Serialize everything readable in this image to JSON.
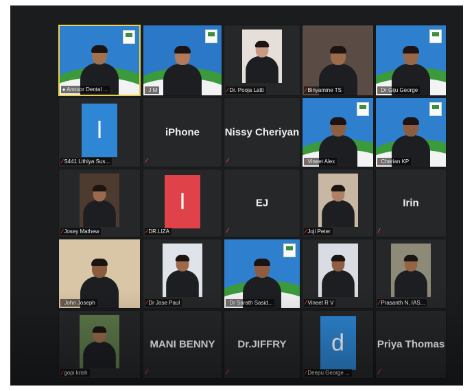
{
  "meeting": {
    "tiles": [
      {
        "id": "annoor",
        "name": "Annoor Dental ...",
        "kind": "video",
        "bg": "#2f7fcf",
        "skin": "#a0704f",
        "active": true
      },
      {
        "id": "jm",
        "name": "J M",
        "kind": "video",
        "bg": "#2c78c8",
        "skin": "#b27a58"
      },
      {
        "id": "pooja",
        "name": "Dr. Pooja Latti",
        "kind": "photo",
        "photo_bg": "#e6dfd9",
        "skin": "#c99983"
      },
      {
        "id": "binyamine",
        "name": "Binyamine TS",
        "kind": "video",
        "bg": "#5a4b44",
        "skin": "#9b6b4b"
      },
      {
        "id": "giju",
        "name": "Dr Giju George",
        "kind": "video",
        "bg": "#2f7fcf",
        "skin": "#98674a"
      },
      {
        "id": "s441",
        "name": "S441 Lithiya Sus...",
        "kind": "letter",
        "letter": "l",
        "letter_bg": "#2e86d4"
      },
      {
        "id": "iphone",
        "name": "iPhone",
        "kind": "name"
      },
      {
        "id": "nissy",
        "name": "Nissy Cheriyan",
        "kind": "name"
      },
      {
        "id": "vineet_alex",
        "name": "Vineet Alex",
        "kind": "video",
        "bg": "#2f7fcf",
        "skin": "#8c5f43"
      },
      {
        "id": "cherian",
        "name": "Cherian KP",
        "kind": "video",
        "bg": "#2f7fcf",
        "skin": "#8d5d42"
      },
      {
        "id": "josey",
        "name": "Josey Mathew",
        "kind": "photo",
        "photo_bg": "#4d3b30",
        "skin": "#9a6a4d"
      },
      {
        "id": "liza",
        "name": "DR.LIZA",
        "kind": "letter",
        "letter": "I",
        "letter_bg": "#e0424a"
      },
      {
        "id": "ej",
        "name": "EJ",
        "kind": "name"
      },
      {
        "id": "joji",
        "name": "Joji Peter",
        "kind": "photo",
        "photo_bg": "#c7b7a3",
        "skin": "#b08064"
      },
      {
        "id": "irin",
        "name": "Irin",
        "kind": "name"
      },
      {
        "id": "john",
        "name": "John Joseph",
        "kind": "video",
        "bg": "#d9c6a6",
        "skin": "#8b5b40"
      },
      {
        "id": "jose",
        "name": "Dr Jose Paul",
        "kind": "photo",
        "photo_bg": "#dfe4ea",
        "skin": "#9f6a4b"
      },
      {
        "id": "sarath",
        "name": "Dr Sarath Sasid...",
        "kind": "video",
        "bg": "#2f7fcf",
        "skin": "#8e5c40"
      },
      {
        "id": "vineet_rv",
        "name": "Vineet R V",
        "kind": "photo",
        "photo_bg": "#d9dde3",
        "skin": "#8f5f44"
      },
      {
        "id": "prasanth",
        "name": "Prasanth N, IAS...",
        "kind": "photo",
        "photo_bg": "#8e8a78",
        "skin": "#946445"
      },
      {
        "id": "gopi",
        "name": "gopi krish",
        "kind": "photo",
        "photo_bg": "#5e7a4b",
        "skin": "#9a6b4c"
      },
      {
        "id": "mani",
        "name": "MANI BENNY",
        "kind": "name"
      },
      {
        "id": "jiffry",
        "name": "Dr.JIFFRY",
        "kind": "name"
      },
      {
        "id": "deepu",
        "name": "Deepu George ...",
        "kind": "letter",
        "letter": "d",
        "letter_bg": "#2e86d4"
      },
      {
        "id": "priya",
        "name": "Priya Thomas",
        "kind": "name"
      }
    ]
  },
  "icons": {
    "muted_mic": "mic-muted-icon"
  },
  "colors": {
    "active_border": "#e8d24a",
    "muted_red": "#ff4a33"
  }
}
